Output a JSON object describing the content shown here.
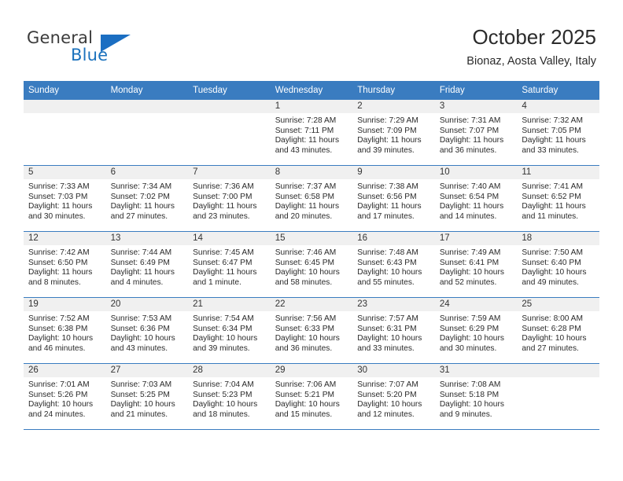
{
  "brand": {
    "name_top": "General",
    "name_bottom": "Blue",
    "accent_color": "#1b6ec2"
  },
  "header": {
    "title": "October 2025",
    "location": "Bionaz, Aosta Valley, Italy"
  },
  "calendar": {
    "header_bg": "#3a7cc0",
    "daynum_bg": "#f0f0f0",
    "weekdays": [
      "Sunday",
      "Monday",
      "Tuesday",
      "Wednesday",
      "Thursday",
      "Friday",
      "Saturday"
    ],
    "weeks": [
      [
        {
          "day": "",
          "sunrise": "",
          "sunset": "",
          "daylight": "",
          "daylight2": ""
        },
        {
          "day": "",
          "sunrise": "",
          "sunset": "",
          "daylight": "",
          "daylight2": ""
        },
        {
          "day": "",
          "sunrise": "",
          "sunset": "",
          "daylight": "",
          "daylight2": ""
        },
        {
          "day": "1",
          "sunrise": "Sunrise: 7:28 AM",
          "sunset": "Sunset: 7:11 PM",
          "daylight": "Daylight: 11 hours",
          "daylight2": "and 43 minutes."
        },
        {
          "day": "2",
          "sunrise": "Sunrise: 7:29 AM",
          "sunset": "Sunset: 7:09 PM",
          "daylight": "Daylight: 11 hours",
          "daylight2": "and 39 minutes."
        },
        {
          "day": "3",
          "sunrise": "Sunrise: 7:31 AM",
          "sunset": "Sunset: 7:07 PM",
          "daylight": "Daylight: 11 hours",
          "daylight2": "and 36 minutes."
        },
        {
          "day": "4",
          "sunrise": "Sunrise: 7:32 AM",
          "sunset": "Sunset: 7:05 PM",
          "daylight": "Daylight: 11 hours",
          "daylight2": "and 33 minutes."
        }
      ],
      [
        {
          "day": "5",
          "sunrise": "Sunrise: 7:33 AM",
          "sunset": "Sunset: 7:03 PM",
          "daylight": "Daylight: 11 hours",
          "daylight2": "and 30 minutes."
        },
        {
          "day": "6",
          "sunrise": "Sunrise: 7:34 AM",
          "sunset": "Sunset: 7:02 PM",
          "daylight": "Daylight: 11 hours",
          "daylight2": "and 27 minutes."
        },
        {
          "day": "7",
          "sunrise": "Sunrise: 7:36 AM",
          "sunset": "Sunset: 7:00 PM",
          "daylight": "Daylight: 11 hours",
          "daylight2": "and 23 minutes."
        },
        {
          "day": "8",
          "sunrise": "Sunrise: 7:37 AM",
          "sunset": "Sunset: 6:58 PM",
          "daylight": "Daylight: 11 hours",
          "daylight2": "and 20 minutes."
        },
        {
          "day": "9",
          "sunrise": "Sunrise: 7:38 AM",
          "sunset": "Sunset: 6:56 PM",
          "daylight": "Daylight: 11 hours",
          "daylight2": "and 17 minutes."
        },
        {
          "day": "10",
          "sunrise": "Sunrise: 7:40 AM",
          "sunset": "Sunset: 6:54 PM",
          "daylight": "Daylight: 11 hours",
          "daylight2": "and 14 minutes."
        },
        {
          "day": "11",
          "sunrise": "Sunrise: 7:41 AM",
          "sunset": "Sunset: 6:52 PM",
          "daylight": "Daylight: 11 hours",
          "daylight2": "and 11 minutes."
        }
      ],
      [
        {
          "day": "12",
          "sunrise": "Sunrise: 7:42 AM",
          "sunset": "Sunset: 6:50 PM",
          "daylight": "Daylight: 11 hours",
          "daylight2": "and 8 minutes."
        },
        {
          "day": "13",
          "sunrise": "Sunrise: 7:44 AM",
          "sunset": "Sunset: 6:49 PM",
          "daylight": "Daylight: 11 hours",
          "daylight2": "and 4 minutes."
        },
        {
          "day": "14",
          "sunrise": "Sunrise: 7:45 AM",
          "sunset": "Sunset: 6:47 PM",
          "daylight": "Daylight: 11 hours",
          "daylight2": "and 1 minute."
        },
        {
          "day": "15",
          "sunrise": "Sunrise: 7:46 AM",
          "sunset": "Sunset: 6:45 PM",
          "daylight": "Daylight: 10 hours",
          "daylight2": "and 58 minutes."
        },
        {
          "day": "16",
          "sunrise": "Sunrise: 7:48 AM",
          "sunset": "Sunset: 6:43 PM",
          "daylight": "Daylight: 10 hours",
          "daylight2": "and 55 minutes."
        },
        {
          "day": "17",
          "sunrise": "Sunrise: 7:49 AM",
          "sunset": "Sunset: 6:41 PM",
          "daylight": "Daylight: 10 hours",
          "daylight2": "and 52 minutes."
        },
        {
          "day": "18",
          "sunrise": "Sunrise: 7:50 AM",
          "sunset": "Sunset: 6:40 PM",
          "daylight": "Daylight: 10 hours",
          "daylight2": "and 49 minutes."
        }
      ],
      [
        {
          "day": "19",
          "sunrise": "Sunrise: 7:52 AM",
          "sunset": "Sunset: 6:38 PM",
          "daylight": "Daylight: 10 hours",
          "daylight2": "and 46 minutes."
        },
        {
          "day": "20",
          "sunrise": "Sunrise: 7:53 AM",
          "sunset": "Sunset: 6:36 PM",
          "daylight": "Daylight: 10 hours",
          "daylight2": "and 43 minutes."
        },
        {
          "day": "21",
          "sunrise": "Sunrise: 7:54 AM",
          "sunset": "Sunset: 6:34 PM",
          "daylight": "Daylight: 10 hours",
          "daylight2": "and 39 minutes."
        },
        {
          "day": "22",
          "sunrise": "Sunrise: 7:56 AM",
          "sunset": "Sunset: 6:33 PM",
          "daylight": "Daylight: 10 hours",
          "daylight2": "and 36 minutes."
        },
        {
          "day": "23",
          "sunrise": "Sunrise: 7:57 AM",
          "sunset": "Sunset: 6:31 PM",
          "daylight": "Daylight: 10 hours",
          "daylight2": "and 33 minutes."
        },
        {
          "day": "24",
          "sunrise": "Sunrise: 7:59 AM",
          "sunset": "Sunset: 6:29 PM",
          "daylight": "Daylight: 10 hours",
          "daylight2": "and 30 minutes."
        },
        {
          "day": "25",
          "sunrise": "Sunrise: 8:00 AM",
          "sunset": "Sunset: 6:28 PM",
          "daylight": "Daylight: 10 hours",
          "daylight2": "and 27 minutes."
        }
      ],
      [
        {
          "day": "26",
          "sunrise": "Sunrise: 7:01 AM",
          "sunset": "Sunset: 5:26 PM",
          "daylight": "Daylight: 10 hours",
          "daylight2": "and 24 minutes."
        },
        {
          "day": "27",
          "sunrise": "Sunrise: 7:03 AM",
          "sunset": "Sunset: 5:25 PM",
          "daylight": "Daylight: 10 hours",
          "daylight2": "and 21 minutes."
        },
        {
          "day": "28",
          "sunrise": "Sunrise: 7:04 AM",
          "sunset": "Sunset: 5:23 PM",
          "daylight": "Daylight: 10 hours",
          "daylight2": "and 18 minutes."
        },
        {
          "day": "29",
          "sunrise": "Sunrise: 7:06 AM",
          "sunset": "Sunset: 5:21 PM",
          "daylight": "Daylight: 10 hours",
          "daylight2": "and 15 minutes."
        },
        {
          "day": "30",
          "sunrise": "Sunrise: 7:07 AM",
          "sunset": "Sunset: 5:20 PM",
          "daylight": "Daylight: 10 hours",
          "daylight2": "and 12 minutes."
        },
        {
          "day": "31",
          "sunrise": "Sunrise: 7:08 AM",
          "sunset": "Sunset: 5:18 PM",
          "daylight": "Daylight: 10 hours",
          "daylight2": "and 9 minutes."
        },
        {
          "day": "",
          "sunrise": "",
          "sunset": "",
          "daylight": "",
          "daylight2": ""
        }
      ]
    ]
  }
}
